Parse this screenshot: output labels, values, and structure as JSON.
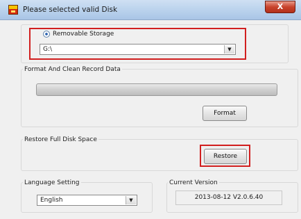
{
  "window": {
    "title": "Please selected valid Disk",
    "close_label": "X"
  },
  "disk": {
    "radio_label": "Removable Storage",
    "selected": true,
    "drive_value": "G:\\",
    "arrow": "▼"
  },
  "format_group": {
    "label": "Format And Clean Record Data",
    "progress": 0,
    "format_button": "Format"
  },
  "restore_group": {
    "label": "Restore Full Disk Space",
    "restore_button": "Restore"
  },
  "language": {
    "label": "Language Setting",
    "value": "English",
    "arrow": "▼"
  },
  "version": {
    "label": "Current Version",
    "value": "2013-08-12 V2.0.6.40"
  },
  "colors": {
    "highlight": "#d11f1f",
    "window_background": "#f0f0f0"
  }
}
